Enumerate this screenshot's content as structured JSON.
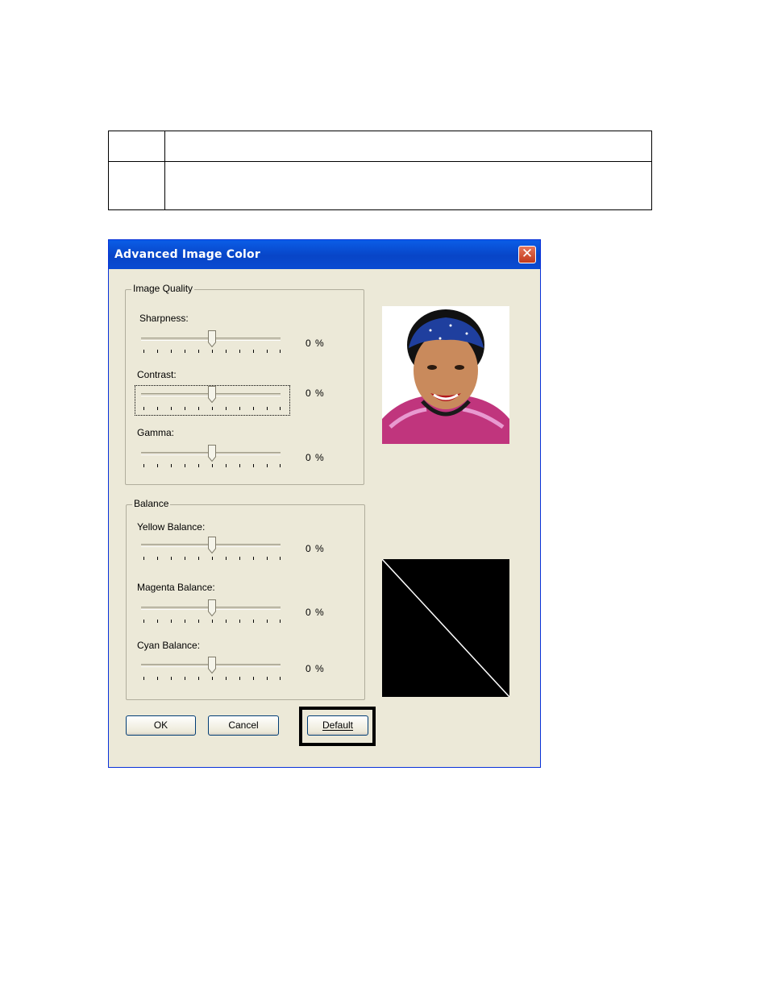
{
  "dialog": {
    "title": "Advanced Image Color",
    "close_glyph": "✕"
  },
  "image_quality": {
    "legend": "Image Quality",
    "sliders": [
      {
        "label": "Sharpness:",
        "value": "0 %",
        "level": 0
      },
      {
        "label": "Contrast:",
        "value": "0 %",
        "level": 0
      },
      {
        "label": "Gamma:",
        "value": "0 %",
        "level": 0
      }
    ]
  },
  "balance": {
    "legend": "Balance",
    "sliders": [
      {
        "label": "Yellow Balance:",
        "value": "0 %",
        "level": 0
      },
      {
        "label": "Magenta Balance:",
        "value": "0 %",
        "level": 0
      },
      {
        "label": "Cyan Balance:",
        "value": "0 %",
        "level": 0
      }
    ]
  },
  "buttons": {
    "ok": "OK",
    "cancel": "Cancel",
    "default": "Default"
  },
  "colors": {
    "title_bar": "#0a5de7",
    "dialog_bg": "#ece9d8",
    "close_button": "#c2391b",
    "highlight": "#000000"
  },
  "icons": {
    "close": "close-icon",
    "slider_thumb": "slider-thumb"
  }
}
